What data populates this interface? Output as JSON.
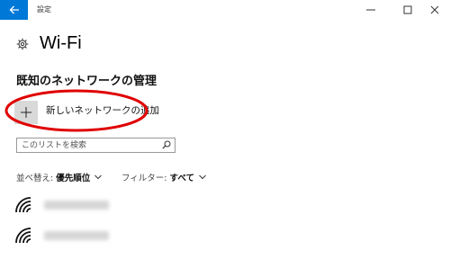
{
  "window": {
    "title": "設定",
    "accent": "#0078d7"
  },
  "header": {
    "title": "Wi-Fi",
    "icon": "gear-icon"
  },
  "section": {
    "heading": "既知のネットワークの管理"
  },
  "add_network": {
    "label": "新しいネットワークの追加",
    "icon": "plus-icon"
  },
  "search": {
    "placeholder": "このリストを検索",
    "icon": "search-icon"
  },
  "sort": {
    "caption": "並べ替え:",
    "value": "優先順位"
  },
  "filter": {
    "caption": "フィルター:",
    "value": "すべて"
  },
  "networks": [
    {
      "icon": "wifi-icon"
    },
    {
      "icon": "wifi-icon"
    }
  ],
  "annotation": {
    "color": "#e00000"
  }
}
